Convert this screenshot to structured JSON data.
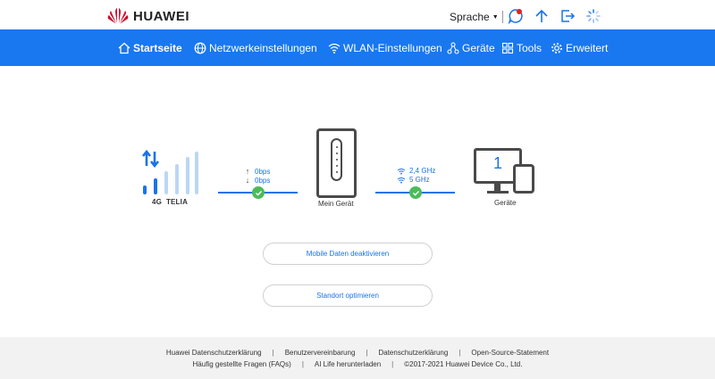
{
  "brand": {
    "name": "HUAWEI",
    "color": "#cf0a2c"
  },
  "header": {
    "language_label": "Sprache",
    "icons": [
      "message-icon",
      "upload-icon",
      "logout-icon",
      "loading-icon"
    ]
  },
  "nav": {
    "items": [
      {
        "label": "Startseite",
        "icon": "home-icon",
        "active": true
      },
      {
        "label": "Netzwerkeinstellungen",
        "icon": "globe-icon",
        "active": false
      },
      {
        "label": "WLAN-Einstellungen",
        "icon": "wifi-icon",
        "active": false
      },
      {
        "label": "Geräte",
        "icon": "devices-icon",
        "active": false
      },
      {
        "label": "Tools",
        "icon": "tools-icon",
        "active": false
      },
      {
        "label": "Erweitert",
        "icon": "gear-icon",
        "active": false
      }
    ]
  },
  "topology": {
    "network": {
      "type": "4G",
      "operator": "TELIA"
    },
    "upload_speed": "0bps",
    "download_speed": "0bps",
    "router_label": "Mein Gerät",
    "wifi_bands": [
      "2,4 GHz",
      "5 GHz"
    ],
    "device_count": "1",
    "devices_label": "Geräte",
    "status_color": "#4cbb5a",
    "accent_color": "#1a73e8"
  },
  "actions": {
    "disable_mobile_data": "Mobile Daten deaktivieren",
    "optimize_location": "Standort optimieren"
  },
  "footer": {
    "row1": [
      "Huawei Datenschutzerklärung",
      "Benutzervereinbarung",
      "Datenschutzerklärung",
      "Open-Source-Statement"
    ],
    "row2": [
      "Häufig gestellte Fragen (FAQs)",
      "AI Life herunterladen",
      "©2017-2021 Huawei Device Co., Ltd."
    ]
  }
}
